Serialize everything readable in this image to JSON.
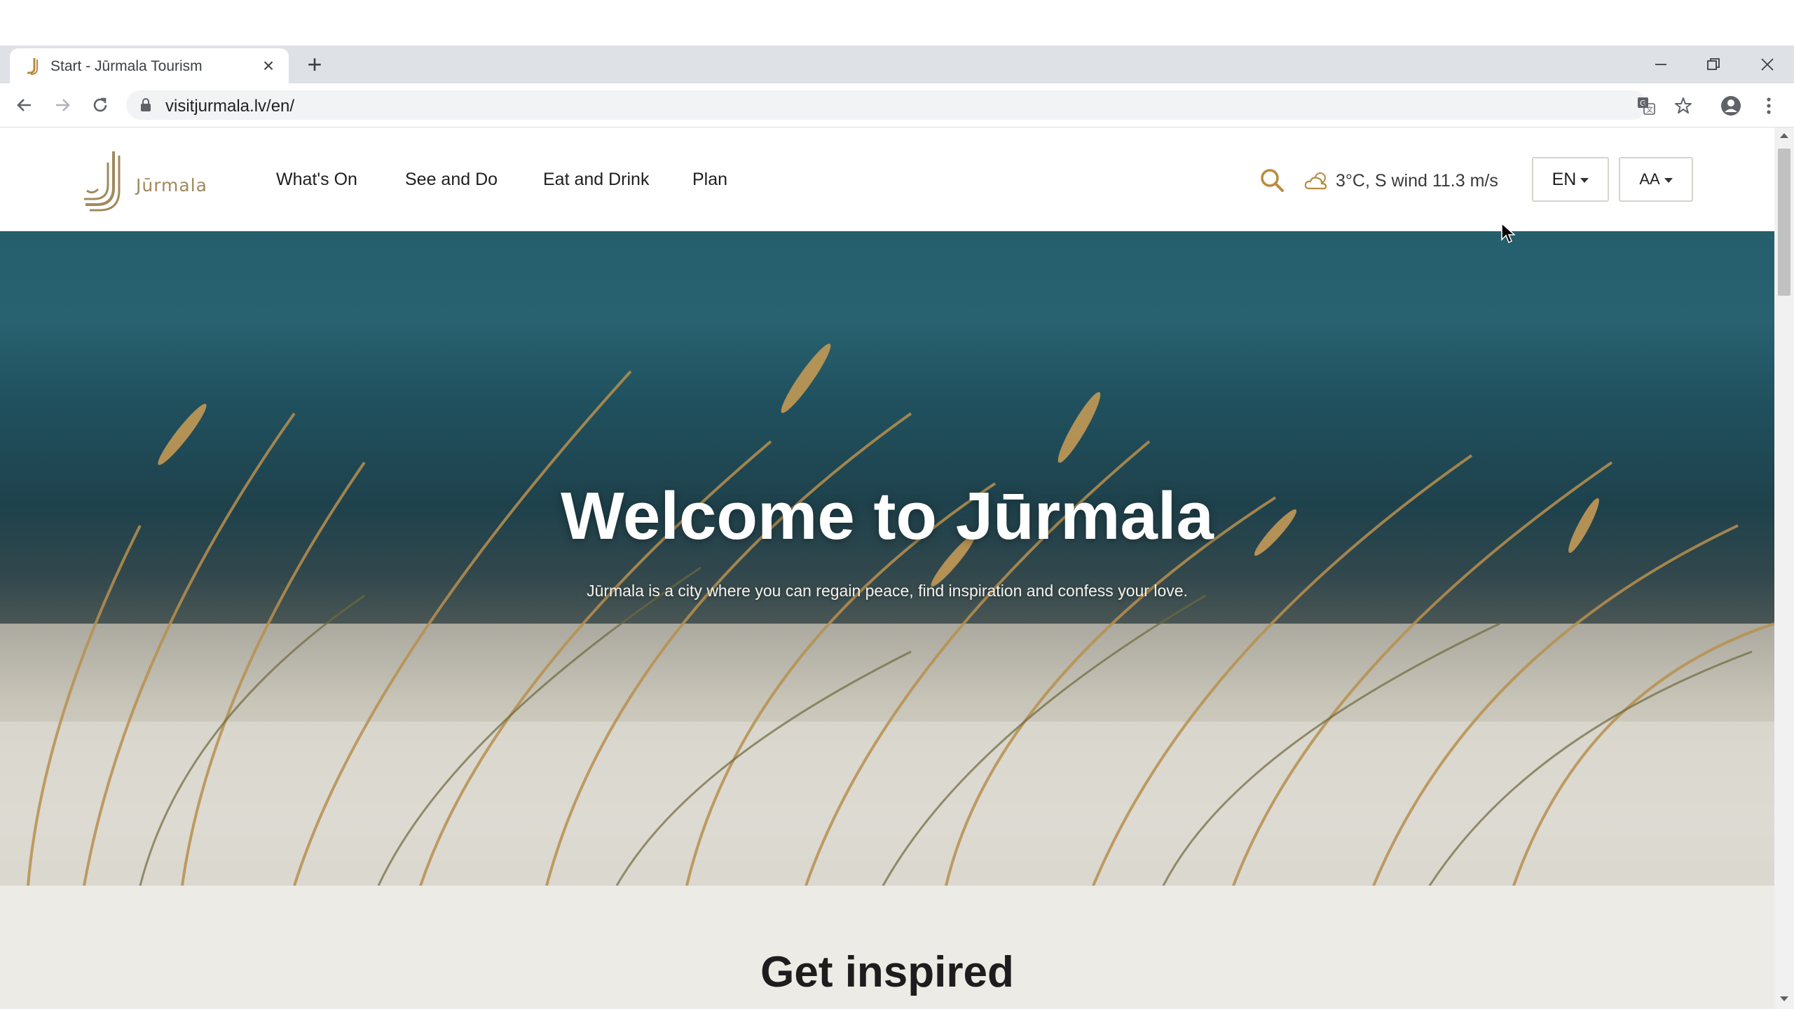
{
  "browser": {
    "tab_title": "Start - Jūrmala Tourism",
    "url": "visitjurmala.lv/en/",
    "window_controls": [
      "minimize",
      "restore",
      "close"
    ]
  },
  "site": {
    "logo_text": "Jūrmala",
    "nav": [
      {
        "label": "What's On"
      },
      {
        "label": "See and Do"
      },
      {
        "label": "Eat and Drink"
      },
      {
        "label": "Plan"
      }
    ],
    "weather": "3°C, S wind 11.3 m/s",
    "language": "EN",
    "text_size": "AA"
  },
  "hero": {
    "title": "Welcome to Jūrmala",
    "subtitle": "Jūrmala is a city where you can regain peace, find inspiration and confess your love."
  },
  "section": {
    "title": "Get inspired"
  },
  "colors": {
    "accent_gold": "#b98b3c",
    "logo_gold": "#a08a5c",
    "section_bg": "#ecebe6"
  }
}
